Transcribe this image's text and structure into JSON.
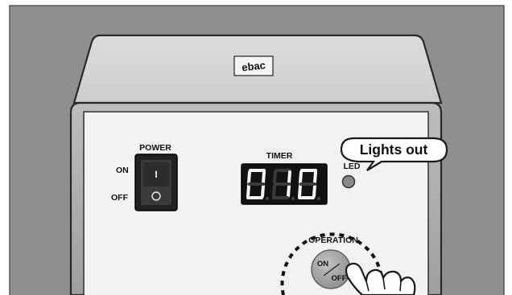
{
  "device": {
    "logo_text": "ebac",
    "panel": {
      "power": {
        "title": "POWER",
        "on_label": "ON",
        "off_label": "OFF",
        "switch_on_mark": "I",
        "switch_off_mark": "O"
      },
      "timer": {
        "title": "TIMER",
        "display_digits": [
          "0",
          "1",
          "0"
        ]
      },
      "led": {
        "label": "LED",
        "state": "off"
      },
      "operation": {
        "title": "OPERATION",
        "button_on": "ON",
        "button_off": "OFF"
      }
    },
    "callout": {
      "text": "Lights out"
    }
  },
  "colors": {
    "background_gray": "#8f8f8f",
    "housing_gray": "#d6d6d6",
    "panel_face": "#f2f2f2",
    "switch_black": "#222222",
    "display_black": "#121212",
    "led_gray": "#8a8a8a",
    "button_gray": "#a9a9a9"
  }
}
